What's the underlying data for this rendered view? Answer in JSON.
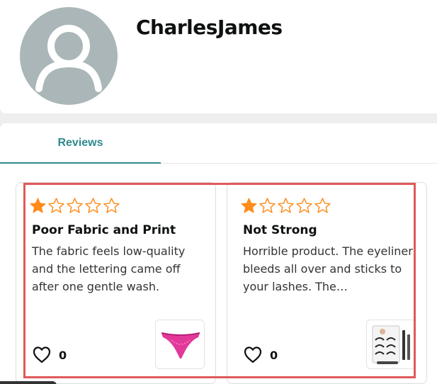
{
  "profile": {
    "name": "CharlesJames"
  },
  "tabs": [
    {
      "label": "Reviews",
      "active": true
    }
  ],
  "reviews": [
    {
      "rating": 1,
      "max_rating": 5,
      "title": "Poor Fabric and Print",
      "body": "The fabric feels low-quality and the lettering came off after one gentle wash.",
      "helpful_count": "0",
      "product_image": "pink-lace-thong-product-icon"
    },
    {
      "rating": 1,
      "max_rating": 5,
      "title": "Not Strong",
      "body": "Horrible product. The eyeliner bleeds all over and sticks to your lashes. The…",
      "helpful_count": "0",
      "product_image": "magnetic-eyelash-kit-product-icon"
    }
  ],
  "colors": {
    "accent": "#2f8a8e",
    "star": "#ff8c1a",
    "highlight": "#e05a5a",
    "avatar": "#aab6b7"
  }
}
